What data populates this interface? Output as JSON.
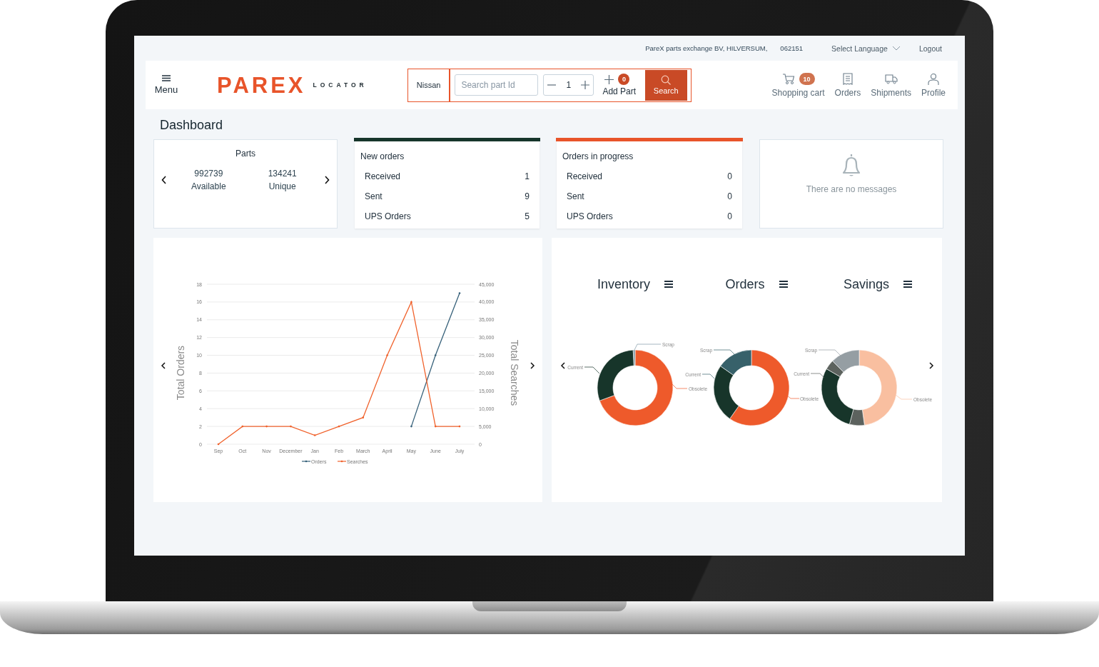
{
  "top_bar": {
    "company": "PareX parts exchange BV, HILVERSUM,",
    "account": "062151",
    "language": "Select Language",
    "logout": "Logout"
  },
  "header": {
    "menu": "Menu",
    "logo": "PAREX",
    "logo_sub": "LOCATOR",
    "brand": "Nissan",
    "search_placeholder": "Search part Id",
    "quantity": "1",
    "add_part": "Add Part",
    "add_part_badge": "0",
    "search_button": "Search",
    "nav": [
      {
        "kind": "cart",
        "label": "Shopping cart",
        "badge": "10"
      },
      {
        "kind": "orders",
        "label": "Orders"
      },
      {
        "kind": "shipments",
        "label": "Shipments"
      },
      {
        "kind": "profile",
        "label": "Profile"
      }
    ]
  },
  "page_title": "Dashboard",
  "cards": [
    {
      "kind": "parts",
      "title": "Parts",
      "stats": [
        {
          "value": "992739",
          "label": "Available"
        },
        {
          "value": "134241",
          "label": "Unique"
        }
      ]
    },
    {
      "kind": "list",
      "title": "New orders",
      "color": "#16352b",
      "rows": [
        {
          "label": "Received",
          "value": "1"
        },
        {
          "label": "Sent",
          "value": "9"
        },
        {
          "label": "UPS Orders",
          "value": "5"
        }
      ]
    },
    {
      "kind": "list",
      "title": "Orders in progress",
      "color": "#e8542a",
      "rows": [
        {
          "label": "Received",
          "value": "0"
        },
        {
          "label": "Sent",
          "value": "0"
        },
        {
          "label": "UPS Orders",
          "value": "0"
        }
      ]
    },
    {
      "kind": "messages",
      "text": "There are no messages"
    }
  ],
  "chart_data": {
    "type": "line",
    "ylabel": "Total Orders",
    "y2label": "Total Searches",
    "categories": [
      "Sep",
      "Oct",
      "Nov",
      "December",
      "Jan",
      "Feb",
      "March",
      "April",
      "May",
      "June",
      "July"
    ],
    "series": [
      {
        "name": "Orders",
        "color": "#37617a",
        "values": [
          null,
          null,
          null,
          null,
          null,
          null,
          null,
          null,
          2,
          10,
          17
        ]
      },
      {
        "name": "Searches",
        "color": "#f0622c",
        "values": [
          0,
          2,
          2,
          2,
          1,
          2,
          3,
          10,
          16,
          2,
          2
        ]
      }
    ],
    "ylim": [
      0,
      18
    ],
    "yticks": [
      0,
      2,
      4,
      6,
      8,
      10,
      12,
      14,
      16,
      18
    ],
    "y2lim": [
      0,
      45000
    ],
    "grid": true,
    "legend": true,
    "y2ticks": [
      {
        "value": 0,
        "label": "0"
      },
      {
        "value": 5000,
        "label": "5,000"
      },
      {
        "value": 10000,
        "label": "10,000"
      },
      {
        "value": 15000,
        "label": "15,000"
      },
      {
        "value": 20000,
        "label": "20,000"
      },
      {
        "value": 25000,
        "label": "25,000"
      },
      {
        "value": 30000,
        "label": "30,000"
      },
      {
        "value": 35000,
        "label": "35,000"
      },
      {
        "value": 40000,
        "label": "40,000"
      },
      {
        "value": 45000,
        "label": "45,000"
      }
    ]
  },
  "donuts": [
    {
      "title": "Inventory",
      "labels": {
        "scrap": "Scrap",
        "current": "Current",
        "obsolete": "Obsolete"
      }
    },
    {
      "title": "Orders",
      "labels": {
        "scrap": "Scrap",
        "current": "Current",
        "obsolete": "Obsolete"
      }
    },
    {
      "title": "Savings",
      "labels": {
        "scrap": "Scrap",
        "current": "Current",
        "obsolete": "Obsolete"
      }
    }
  ]
}
